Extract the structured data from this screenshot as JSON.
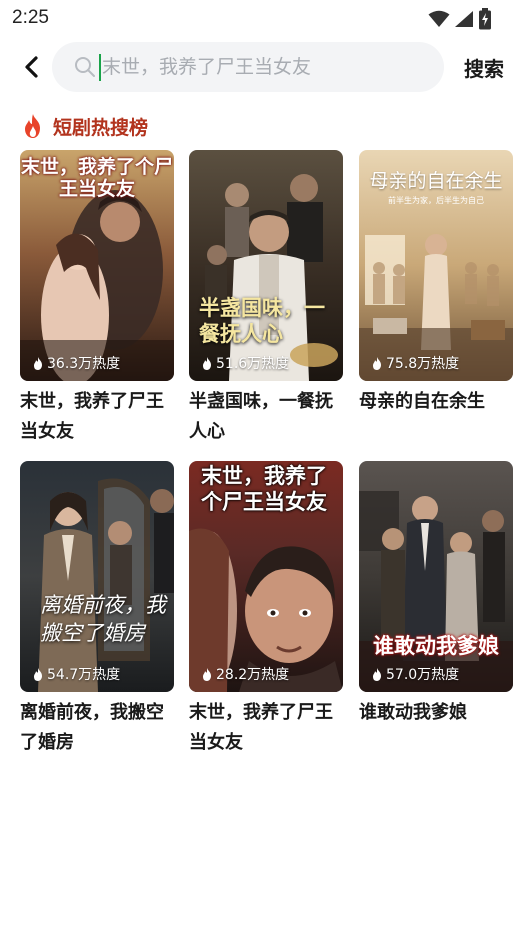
{
  "status_bar": {
    "time": "2:25"
  },
  "search": {
    "placeholder": "末世，我养了尸王当女友",
    "button_label": "搜索"
  },
  "section": {
    "title": "短剧热搜榜"
  },
  "dramas": [
    {
      "title": "末世，我养了尸王当女友",
      "heat": "36.3万热度",
      "poster_text": "末世，我养了个尸王当女友"
    },
    {
      "title": "半盏国味，一餐抚人心",
      "heat": "51.6万热度",
      "poster_text": "半盏国味，一餐抚人心"
    },
    {
      "title": "母亲的自在余生",
      "heat": "75.8万热度",
      "poster_text": "母亲的自在余生",
      "poster_subtext": "前半生为家，后半生为自己"
    },
    {
      "title": "离婚前夜，我搬空了婚房",
      "heat": "54.7万热度",
      "poster_text": "离婚前夜，我搬空了婚房"
    },
    {
      "title": "末世，我养了尸王当女友",
      "heat": "28.2万热度",
      "poster_text": "末世，我养了个尸王当女友"
    },
    {
      "title": "谁敢动我爹娘",
      "heat": "57.0万热度",
      "poster_text": "谁敢动我爹娘"
    }
  ]
}
